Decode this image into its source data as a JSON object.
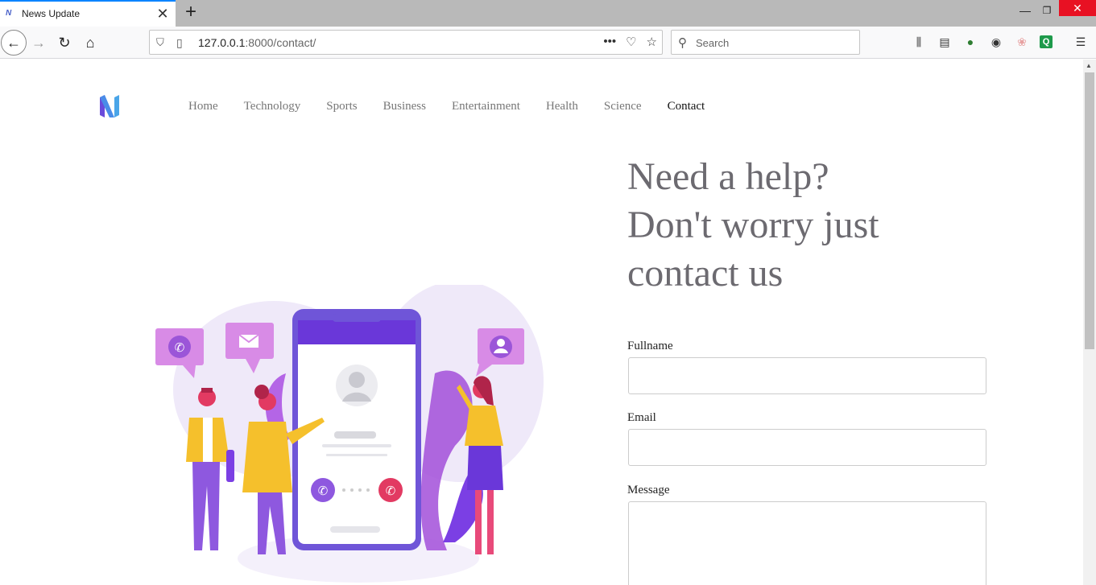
{
  "browser": {
    "tab_title": "News Update",
    "url_host": "127.0.0.1",
    "url_rest": ":8000/contact/",
    "search_placeholder": "Search"
  },
  "site": {
    "nav": [
      {
        "label": "Home"
      },
      {
        "label": "Technology"
      },
      {
        "label": "Sports"
      },
      {
        "label": "Business"
      },
      {
        "label": "Entertainment"
      },
      {
        "label": "Health"
      },
      {
        "label": "Science"
      },
      {
        "label": "Contact",
        "active": true
      }
    ],
    "headline_line1": "Need a help?",
    "headline_line2": "Don't worry just",
    "headline_line3": "contact us",
    "form": {
      "fullname_label": "Fullname",
      "email_label": "Email",
      "message_label": "Message"
    }
  },
  "colors": {
    "accent_purple": "#7b3fe4",
    "light_lavender": "#efe9f9",
    "yellow": "#f5c02c",
    "pink": "#e84a7a"
  }
}
